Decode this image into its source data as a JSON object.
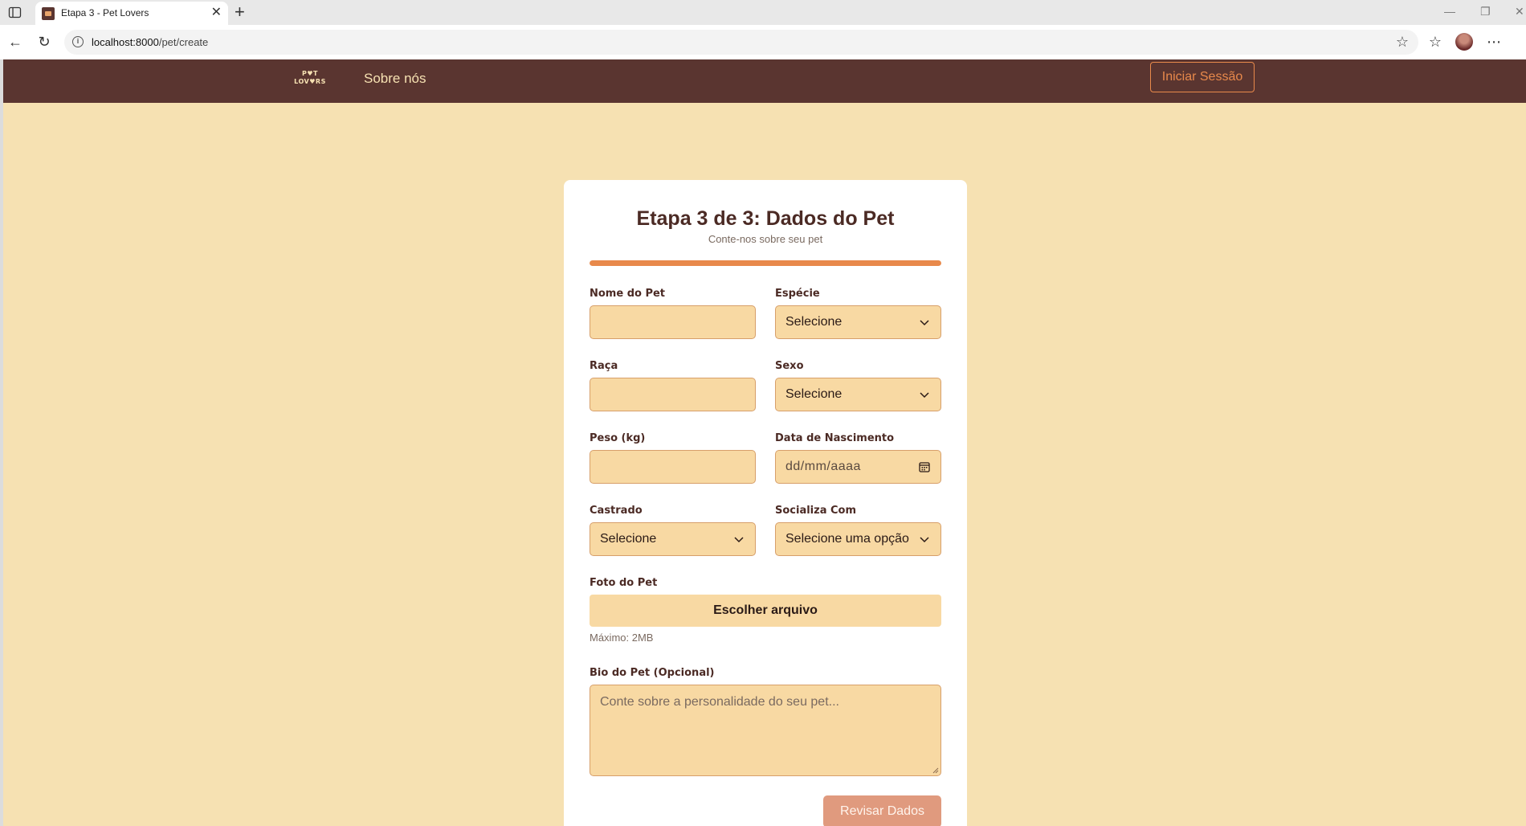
{
  "browser": {
    "tab_title": "Etapa 3 - Pet Lovers",
    "tab_close": "✕",
    "new_tab": "+",
    "url_host": "localhost:8000",
    "url_path": "/pet/create"
  },
  "navbar": {
    "logo_line1": "P♥T",
    "logo_line2": "LOV♥RS",
    "link_about": "Sobre nós",
    "login_button": "Iniciar Sessão"
  },
  "form": {
    "title": "Etapa 3 de 3: Dados do Pet",
    "subtitle": "Conte-nos sobre seu pet",
    "progress_percent": 100,
    "fields": {
      "nome_label": "Nome do Pet",
      "especie_label": "Espécie",
      "especie_value": "Selecione",
      "raca_label": "Raça",
      "sexo_label": "Sexo",
      "sexo_value": "Selecione",
      "peso_label": "Peso (kg)",
      "nascimento_label": "Data de Nascimento",
      "nascimento_placeholder": "dd/mm/aaaa",
      "castrado_label": "Castrado",
      "castrado_value": "Selecione",
      "socializa_label": "Socializa Com",
      "socializa_value": "Selecione uma opção",
      "foto_label": "Foto do Pet",
      "foto_button": "Escolher arquivo",
      "foto_hint": "Máximo: 2MB",
      "bio_label": "Bio do Pet (Opcional)",
      "bio_placeholder": "Conte sobre a personalidade do seu pet..."
    },
    "submit_button": "Revisar Dados"
  },
  "colors": {
    "navbar": "#5a3530",
    "page_bg": "#f6e1b2",
    "accent": "#e8894b",
    "field_bg": "#f8d9a3",
    "submit_bg": "#e09a7e"
  }
}
